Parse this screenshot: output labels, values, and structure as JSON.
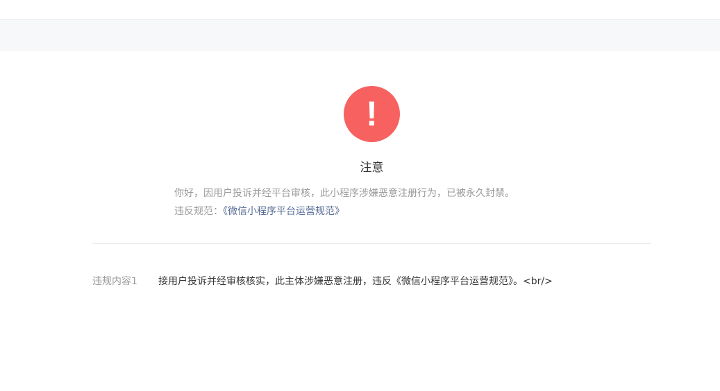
{
  "notice": {
    "icon": "exclamation-icon",
    "icon_glyph": "!",
    "icon_color": "#f76260",
    "title": "注意",
    "message": "你好，因用户投诉并经平台审核，此小程序涉嫌恶意注册行为，已被永久封禁。",
    "rule_prefix": "违反规范：",
    "rule_link": "《微信小程序平台运营规范》",
    "link_color": "#576b95"
  },
  "violation": {
    "label": "违规内容1",
    "content": "接用户投诉并经审核核实，此主体涉嫌恶意注册，违反《微信小程序平台运营规范》。<br/>"
  }
}
